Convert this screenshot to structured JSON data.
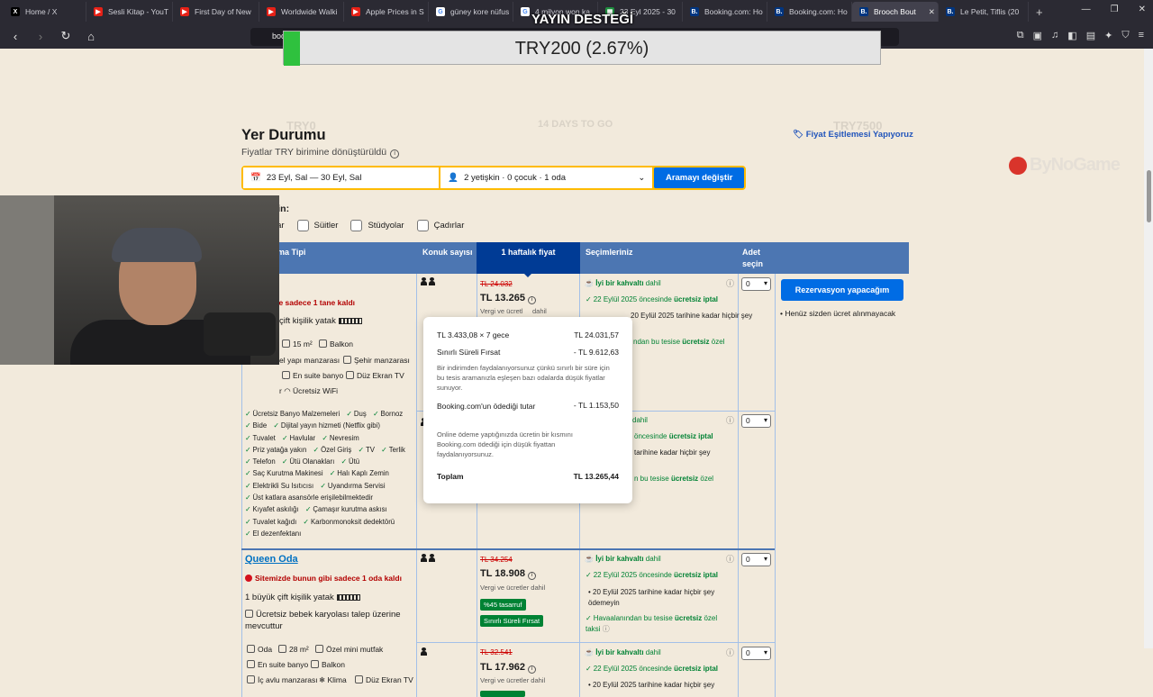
{
  "browser": {
    "tabs": [
      {
        "label": "Home / X",
        "icon": "x-icon"
      },
      {
        "label": "Sesli Kitap - YouT",
        "icon": "youtube-icon"
      },
      {
        "label": "First Day of New",
        "icon": "youtube-icon"
      },
      {
        "label": "Worldwide Walki",
        "icon": "youtube-icon"
      },
      {
        "label": "Apple Prices in S",
        "icon": "youtube-icon"
      },
      {
        "label": "güney kore nüfus",
        "icon": "google-icon"
      },
      {
        "label": "4 milyon won ka",
        "icon": "google-icon"
      },
      {
        "label": "23 Eyl 2025 - 30",
        "icon": "sheet-icon"
      },
      {
        "label": "Booking.com: Ho",
        "icon": "booking-icon"
      },
      {
        "label": "Booking.com: Ho",
        "icon": "booking-icon"
      },
      {
        "label": "Brooch Bout",
        "icon": "booking-icon",
        "active": true
      },
      {
        "label": "Le Petit, Tiflis (20",
        "icon": "booking-icon"
      }
    ],
    "url": "boo"
  },
  "overlay": {
    "title": "YAYIN DESTEĞİ",
    "amount": "TRY200 (2.67%)",
    "ghost_left": "TRY0",
    "ghost_mid": "14 DAYS TO GO",
    "ghost_right": "TRY7500"
  },
  "watermark": "ByNoGame",
  "page": {
    "title": "Yer Durumu",
    "subtitle": "Fiyatlar TRY birimine dönüştürüldü",
    "price_match": "Fiyat Eşitlemesi Yapıyoruz",
    "search": {
      "dates": "23 Eyl, Sal  —  30 Eyl, Sal",
      "guests": "2 yetişkin · 0 çocuk · 1 oda",
      "button": "Aramayı değiştir"
    },
    "filter_label": "Filtreleyin:",
    "filters": [
      "Odalar",
      "Süitler",
      "Stüdyolar",
      "Çadırlar"
    ],
    "table_headers": {
      "room_type": "ma Tipi",
      "guests": "Konuk sayısı",
      "price": "1 haftalık fiyat",
      "options": "Seçimleriniz",
      "qty_line1": "Adet",
      "qty_line2": "seçin"
    },
    "room1": {
      "availability": "zde sadece 1 tane kaldı",
      "bed": "çift kişilik yatak",
      "size": "15 m²",
      "balcony": "Balkon",
      "view1": "el yapı manzarası",
      "view2": "Şehir manzarası",
      "bath": "En suite banyo",
      "tv": "Düz Ekran TV",
      "wifi_pre": "r",
      "wifi": "Ücretsiz WiFi",
      "amenities": [
        "Ücretsiz Banyo Malzemeleri",
        "Duş",
        "Bornoz",
        "Bide",
        "Dijital yayın hizmeti (Netflix gibi)",
        "Tuvalet",
        "Havlular",
        "Nevresim",
        "Priz yatağa yakın",
        "Özel Giriş",
        "TV",
        "Terlik",
        "Telefon",
        "Ütü Olanakları",
        "Ütü",
        "Saç Kurutma Makinesi",
        "Halı Kaplı Zemin",
        "Elektrikli Su Isıtıcısı",
        "Uyandırma Servisi",
        "Üst katlara asansörle erişilebilmektedir",
        "Kıyafet askılığı",
        "Çamaşır kurutma askısı",
        "Tuvalet kağıdı",
        "Karbonmonoksit dedektörü",
        "El dezenfektanı"
      ],
      "rate1": {
        "old_price": "TL 24.032",
        "price": "TL 13.265",
        "tax": "Vergi ve ücretl",
        "tax2": "dahil",
        "breakfast": "İyi bir kahvaltı",
        "breakfast_suffix": "dahil",
        "cancel_pre": "22 Eylül 2025 öncesinde",
        "cancel_bold": "ücretsiz iptal",
        "pay": "20 Eylül 2025 tarihine kadar hiçbir şey",
        "airport_pre": "ndan bu tesise",
        "airport_bold": "ücretsiz",
        "airport_post": "özel",
        "qty": "0"
      },
      "rate2": {
        "breakfast_suffix": "dahil",
        "cancel_bold": "ücretsiz iptal",
        "cancel_pre": "öncesinde",
        "pay": "tarihine kadar hiçbir şey",
        "airport_pre": "n bu tesise",
        "airport_bold": "ücretsiz",
        "airport_post": "özel",
        "qty": "0"
      }
    },
    "reserve_button": "Rezervasyon yapacağım",
    "reserve_note": "Henüz sizden ücret alınmayacak",
    "tooltip": {
      "line1_label": "TL 3.433,08 × 7 gece",
      "line1_value": "TL 24.031,57",
      "line2_label": "Sınırlı Süreli Fırsat",
      "line2_value": "- TL 9.612,63",
      "line2_note": "Bir indirimden faydalanıyorsunuz çünkü sınırlı bir süre için bu tesis aramanızla eşleşen bazı odalarda düşük fiyatlar sunuyor.",
      "line3_label": "Booking.com'un ödediği tutar",
      "line3_value": "- TL 1.153,50",
      "line3_note": "Online ödeme yaptığınızda ücretin bir kısmını Booking.com ödediği için düşük fiyattan faydalanıyorsunuz.",
      "total_label": "Toplam",
      "total_value": "TL 13.265,44"
    },
    "room2": {
      "name": "Queen Oda",
      "availability": "Sitemizde bunun gibi sadece 1 oda kaldı",
      "bed": "1 büyük çift kişilik yatak",
      "crib": "Ücretsiz bebek karyolası talep üzerine mevcuttur",
      "f1": "Oda",
      "f2": "28 m²",
      "f3": "Özel mini mutfak",
      "f4": "En suite banyo",
      "f5": "Balkon",
      "f6": "İç avlu manzarası",
      "f7": "Klima",
      "f8": "Düz Ekran TV",
      "rate1": {
        "old_price": "TL 34.254",
        "price": "TL 18.908",
        "tax": "Vergi ve ücretler dahil",
        "badge1": "%45 tasarruf",
        "badge2": "Sınırlı Süreli Fırsat",
        "breakfast": "İyi bir kahvaltı",
        "breakfast_suffix": "dahil",
        "cancel_pre": "22 Eylül 2025 öncesinde",
        "cancel_bold": "ücretsiz iptal",
        "pay": "20 Eylül 2025 tarihine kadar hiçbir şey ödemeyin",
        "airport_pre": "Havaalanından bu tesise",
        "airport_bold": "ücretsiz",
        "airport_post": "özel",
        "airport_end": "taksi",
        "qty": "0"
      },
      "rate2": {
        "old_price": "TL 32.541",
        "price": "TL 17.962",
        "tax": "Vergi ve ücretler dahil",
        "breakfast": "İyi bir kahvaltı",
        "breakfast_suffix": "dahil",
        "cancel_pre": "22 Eylül 2025 öncesinde",
        "cancel_bold": "ücretsiz iptal",
        "pay": "20 Eylül 2025 tarihine kadar hiçbir şey",
        "qty": "0"
      }
    }
  }
}
